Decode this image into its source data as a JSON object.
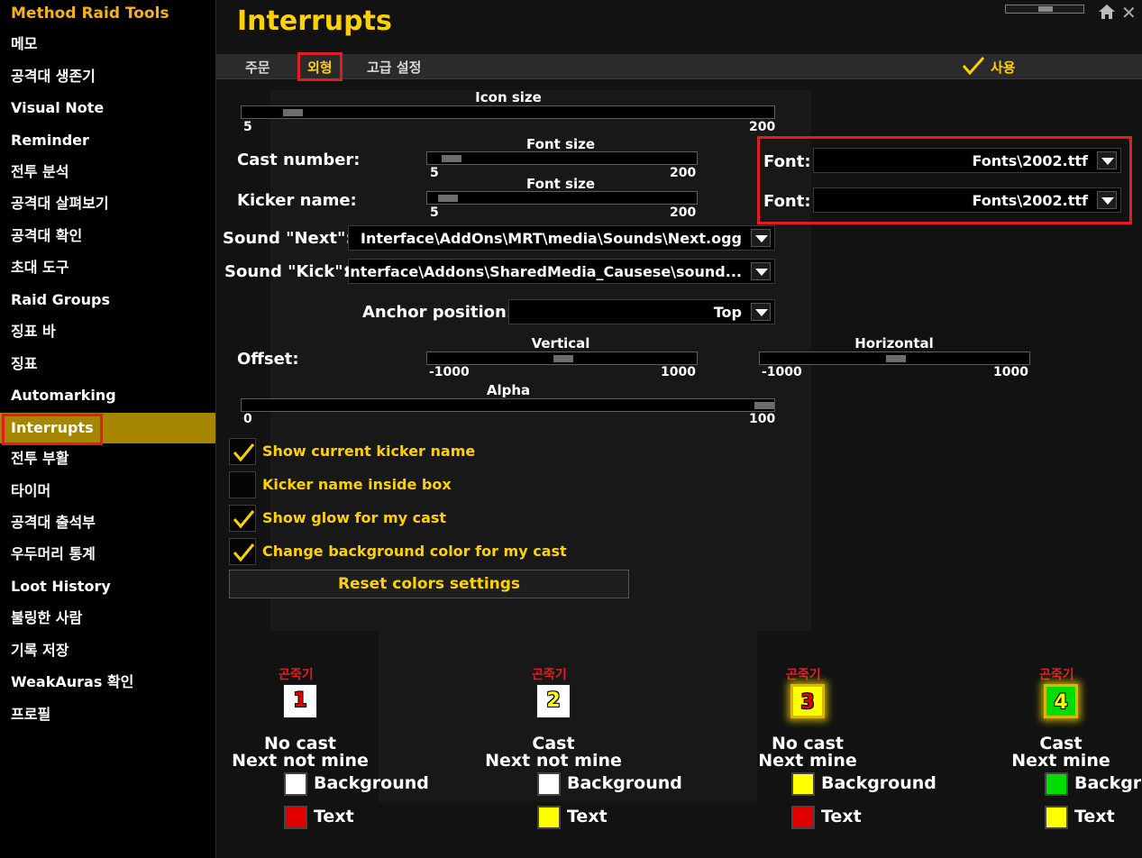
{
  "app": {
    "title": "Method Raid Tools",
    "page_title": "Interrupts",
    "close_glyph": "✕"
  },
  "sidebar": {
    "items": [
      {
        "label": "메모"
      },
      {
        "label": "공격대 생존기"
      },
      {
        "label": "Visual Note"
      },
      {
        "label": "Reminder"
      },
      {
        "label": "전투 분석"
      },
      {
        "label": "공격대 살펴보기"
      },
      {
        "label": "공격대 확인"
      },
      {
        "label": "초대 도구"
      },
      {
        "label": "Raid Groups"
      },
      {
        "label": "징표 바"
      },
      {
        "label": "징표"
      },
      {
        "label": "Automarking"
      },
      {
        "label": "Interrupts"
      },
      {
        "label": "전투 부활"
      },
      {
        "label": "타이머"
      },
      {
        "label": "공격대 출석부"
      },
      {
        "label": "우두머리 통계"
      },
      {
        "label": "Loot History"
      },
      {
        "label": "불링한 사람"
      },
      {
        "label": "기록 저장"
      },
      {
        "label": "WeakAuras 확인"
      },
      {
        "label": "프로필"
      }
    ],
    "active_index": 12
  },
  "tabs": [
    {
      "label": "주문"
    },
    {
      "label": "외형"
    },
    {
      "label": "고급 설정"
    }
  ],
  "active_tab": 1,
  "enable": {
    "label": "사용",
    "checked": true
  },
  "icon_size": {
    "label": "Icon size",
    "min": "5",
    "max": "200",
    "value": 20
  },
  "cast_number": {
    "label": "Cast number:",
    "font_size_label": "Font size",
    "min": "5",
    "max": "200",
    "value": 15,
    "font_label": "Font:",
    "font_value": "Fonts\\2002.ttf"
  },
  "kicker_name": {
    "label": "Kicker name:",
    "font_size_label": "Font size",
    "min": "5",
    "max": "200",
    "value": 12,
    "font_label": "Font:",
    "font_value": "Fonts\\2002.ttf"
  },
  "sound_next": {
    "label": "Sound \"Next\":",
    "value": "Interface\\AddOns\\MRT\\media\\Sounds\\Next.ogg"
  },
  "sound_kick": {
    "label": "Sound \"Kick\":",
    "value": "Interface\\Addons\\SharedMedia_Causese\\sound..."
  },
  "anchor": {
    "label": "Anchor position:",
    "value": "Top"
  },
  "offset": {
    "label": "Offset:",
    "vertical": {
      "label": "Vertical",
      "min": "-1000",
      "max": "1000",
      "value": 0
    },
    "horizontal": {
      "label": "Horizontal",
      "min": "-1000",
      "max": "1000",
      "value": 0
    }
  },
  "alpha": {
    "label": "Alpha",
    "min": "0",
    "max": "100",
    "value": 100
  },
  "checkboxes": [
    {
      "label": "Show current kicker name",
      "checked": true
    },
    {
      "label": "Kicker name inside box",
      "checked": false
    },
    {
      "label": "Show glow for my cast",
      "checked": true
    },
    {
      "label": "Change background color for my cast",
      "checked": true
    }
  ],
  "reset_button": "Reset colors settings",
  "previews": [
    {
      "name": "곤죽기",
      "number": "1",
      "line1": "No cast",
      "line2": "Next not mine",
      "bg_label": "Background",
      "text_label": "Text",
      "bg_color": "#ffffff",
      "text_color": "#e00000",
      "glow": false
    },
    {
      "name": "곤죽기",
      "number": "2",
      "line1": "Cast",
      "line2": "Next not mine",
      "bg_label": "Background",
      "text_label": "Text",
      "bg_color": "#ffffff",
      "text_color": "#ffff00",
      "glow": false
    },
    {
      "name": "곤죽기",
      "number": "3",
      "line1": "No cast",
      "line2": "Next mine",
      "bg_label": "Background",
      "text_label": "Text",
      "bg_color": "#ffff00",
      "text_color": "#e00000",
      "glow": true
    },
    {
      "name": "곤죽기",
      "number": "4",
      "line1": "Cast",
      "line2": "Next mine",
      "bg_label": "Background",
      "text_label": "Text",
      "bg_color": "#00dd00",
      "text_color": "#ffff00",
      "glow": true
    }
  ],
  "colors": {
    "accent": "#ffd100",
    "highlight": "#e21c24",
    "active_bg": "#a68600"
  }
}
